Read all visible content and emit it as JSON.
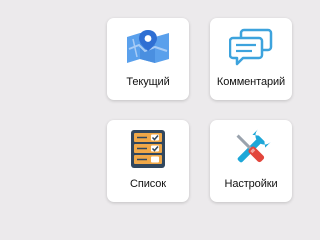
{
  "tiles": [
    {
      "label": "Текущий",
      "icon": "map-pin-icon"
    },
    {
      "label": "Комментарий",
      "icon": "chat-bubbles-icon"
    },
    {
      "label": "Список",
      "icon": "checklist-icon"
    },
    {
      "label": "Настройки",
      "icon": "wrench-screwdriver-icon"
    }
  ],
  "colors": {
    "background": "#eceaec",
    "tile": "#ffffff",
    "map_blue": "#5aa0ec",
    "chat_blue": "#3da3dd",
    "list_orange": "#f0a848",
    "list_dark": "#31475e",
    "tool_cyan": "#1ea7d8",
    "tool_red": "#e2463c"
  }
}
